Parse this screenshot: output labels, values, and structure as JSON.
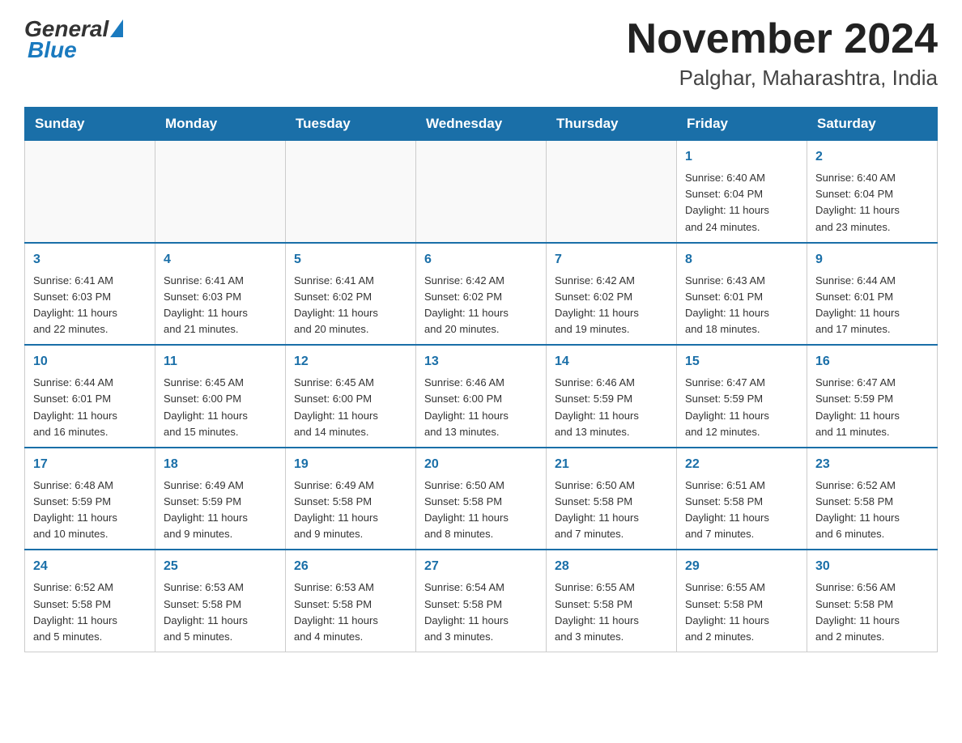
{
  "header": {
    "logo_general": "General",
    "logo_blue": "Blue",
    "title": "November 2024",
    "subtitle": "Palghar, Maharashtra, India"
  },
  "weekdays": [
    "Sunday",
    "Monday",
    "Tuesday",
    "Wednesday",
    "Thursday",
    "Friday",
    "Saturday"
  ],
  "weeks": [
    [
      {
        "day": "",
        "info": ""
      },
      {
        "day": "",
        "info": ""
      },
      {
        "day": "",
        "info": ""
      },
      {
        "day": "",
        "info": ""
      },
      {
        "day": "",
        "info": ""
      },
      {
        "day": "1",
        "info": "Sunrise: 6:40 AM\nSunset: 6:04 PM\nDaylight: 11 hours\nand 24 minutes."
      },
      {
        "day": "2",
        "info": "Sunrise: 6:40 AM\nSunset: 6:04 PM\nDaylight: 11 hours\nand 23 minutes."
      }
    ],
    [
      {
        "day": "3",
        "info": "Sunrise: 6:41 AM\nSunset: 6:03 PM\nDaylight: 11 hours\nand 22 minutes."
      },
      {
        "day": "4",
        "info": "Sunrise: 6:41 AM\nSunset: 6:03 PM\nDaylight: 11 hours\nand 21 minutes."
      },
      {
        "day": "5",
        "info": "Sunrise: 6:41 AM\nSunset: 6:02 PM\nDaylight: 11 hours\nand 20 minutes."
      },
      {
        "day": "6",
        "info": "Sunrise: 6:42 AM\nSunset: 6:02 PM\nDaylight: 11 hours\nand 20 minutes."
      },
      {
        "day": "7",
        "info": "Sunrise: 6:42 AM\nSunset: 6:02 PM\nDaylight: 11 hours\nand 19 minutes."
      },
      {
        "day": "8",
        "info": "Sunrise: 6:43 AM\nSunset: 6:01 PM\nDaylight: 11 hours\nand 18 minutes."
      },
      {
        "day": "9",
        "info": "Sunrise: 6:44 AM\nSunset: 6:01 PM\nDaylight: 11 hours\nand 17 minutes."
      }
    ],
    [
      {
        "day": "10",
        "info": "Sunrise: 6:44 AM\nSunset: 6:01 PM\nDaylight: 11 hours\nand 16 minutes."
      },
      {
        "day": "11",
        "info": "Sunrise: 6:45 AM\nSunset: 6:00 PM\nDaylight: 11 hours\nand 15 minutes."
      },
      {
        "day": "12",
        "info": "Sunrise: 6:45 AM\nSunset: 6:00 PM\nDaylight: 11 hours\nand 14 minutes."
      },
      {
        "day": "13",
        "info": "Sunrise: 6:46 AM\nSunset: 6:00 PM\nDaylight: 11 hours\nand 13 minutes."
      },
      {
        "day": "14",
        "info": "Sunrise: 6:46 AM\nSunset: 5:59 PM\nDaylight: 11 hours\nand 13 minutes."
      },
      {
        "day": "15",
        "info": "Sunrise: 6:47 AM\nSunset: 5:59 PM\nDaylight: 11 hours\nand 12 minutes."
      },
      {
        "day": "16",
        "info": "Sunrise: 6:47 AM\nSunset: 5:59 PM\nDaylight: 11 hours\nand 11 minutes."
      }
    ],
    [
      {
        "day": "17",
        "info": "Sunrise: 6:48 AM\nSunset: 5:59 PM\nDaylight: 11 hours\nand 10 minutes."
      },
      {
        "day": "18",
        "info": "Sunrise: 6:49 AM\nSunset: 5:59 PM\nDaylight: 11 hours\nand 9 minutes."
      },
      {
        "day": "19",
        "info": "Sunrise: 6:49 AM\nSunset: 5:58 PM\nDaylight: 11 hours\nand 9 minutes."
      },
      {
        "day": "20",
        "info": "Sunrise: 6:50 AM\nSunset: 5:58 PM\nDaylight: 11 hours\nand 8 minutes."
      },
      {
        "day": "21",
        "info": "Sunrise: 6:50 AM\nSunset: 5:58 PM\nDaylight: 11 hours\nand 7 minutes."
      },
      {
        "day": "22",
        "info": "Sunrise: 6:51 AM\nSunset: 5:58 PM\nDaylight: 11 hours\nand 7 minutes."
      },
      {
        "day": "23",
        "info": "Sunrise: 6:52 AM\nSunset: 5:58 PM\nDaylight: 11 hours\nand 6 minutes."
      }
    ],
    [
      {
        "day": "24",
        "info": "Sunrise: 6:52 AM\nSunset: 5:58 PM\nDaylight: 11 hours\nand 5 minutes."
      },
      {
        "day": "25",
        "info": "Sunrise: 6:53 AM\nSunset: 5:58 PM\nDaylight: 11 hours\nand 5 minutes."
      },
      {
        "day": "26",
        "info": "Sunrise: 6:53 AM\nSunset: 5:58 PM\nDaylight: 11 hours\nand 4 minutes."
      },
      {
        "day": "27",
        "info": "Sunrise: 6:54 AM\nSunset: 5:58 PM\nDaylight: 11 hours\nand 3 minutes."
      },
      {
        "day": "28",
        "info": "Sunrise: 6:55 AM\nSunset: 5:58 PM\nDaylight: 11 hours\nand 3 minutes."
      },
      {
        "day": "29",
        "info": "Sunrise: 6:55 AM\nSunset: 5:58 PM\nDaylight: 11 hours\nand 2 minutes."
      },
      {
        "day": "30",
        "info": "Sunrise: 6:56 AM\nSunset: 5:58 PM\nDaylight: 11 hours\nand 2 minutes."
      }
    ]
  ]
}
